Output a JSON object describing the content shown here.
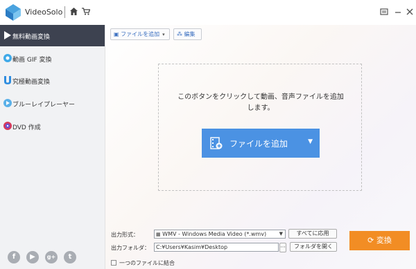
{
  "app": {
    "name": "VideoSolo"
  },
  "sidebar": {
    "items": [
      {
        "label": "無料動画変換",
        "icon": "convert-icon"
      },
      {
        "label": "動画 GIF 変換",
        "icon": "gif-icon"
      },
      {
        "label": "究極動画変換",
        "icon": "ultimate-convert-icon"
      },
      {
        "label": "ブルーレイプレーヤー",
        "icon": "bluray-player-icon"
      },
      {
        "label": "DVD 作成",
        "icon": "dvd-creator-icon"
      }
    ],
    "social": [
      "f",
      "▶",
      "g+",
      "t"
    ]
  },
  "toolbar": {
    "add_file": "ファイルを追加",
    "edit": "編集"
  },
  "dropzone": {
    "hint_line1": "このボタンをクリックして動画、音声ファイルを追加",
    "hint_line2": "します。",
    "button_label": "ファイルを追加"
  },
  "output": {
    "format_label": "出力形式：",
    "format_value": "WMV - Windows Media Video (*.wmv)",
    "apply_all": "すべてに応用",
    "folder_label": "出力フォルダ：",
    "folder_value": "C:¥Users¥Kasim¥Desktop",
    "browse": "···",
    "open_folder": "フォルダを開く",
    "merge_label": "一つのファイルに結合",
    "convert": "変換"
  },
  "colors": {
    "accent_blue": "#4b92e3",
    "convert_orange": "#f28d24",
    "sidebar_active": "#3d4250"
  }
}
